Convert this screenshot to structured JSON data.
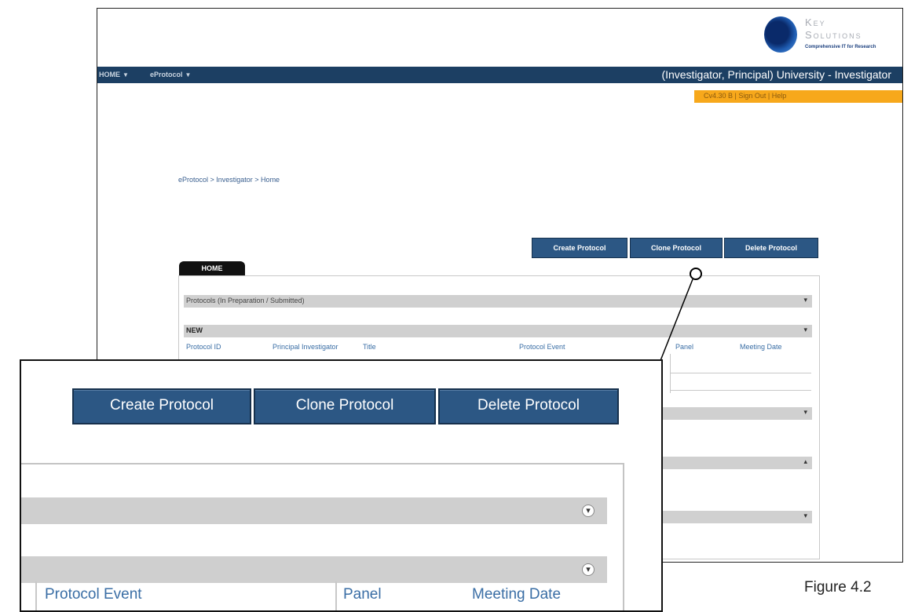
{
  "logo": {
    "line1": "Key",
    "line2": "Solutions",
    "tagline": "Comprehensive IT for Research"
  },
  "navbar": {
    "menus": [
      {
        "label": "HOME"
      },
      {
        "label": "eProtocol"
      }
    ],
    "role_text": "(Investigator, Principal) University - Investigator"
  },
  "userbar": {
    "text": "Cv4.30 B  |  Sign Out  |  Help"
  },
  "breadcrumb": "eProtocol > Investigator > Home",
  "toolbar": {
    "create": "Create Protocol",
    "clone": "Clone Protocol",
    "delete": "Delete Protocol"
  },
  "tab": {
    "label": "HOME"
  },
  "sections": {
    "prep": "Protocols (In Preparation / Submitted)",
    "new": "NEW"
  },
  "columns": [
    "Protocol ID",
    "Principal Investigator",
    "Title",
    "Protocol Event",
    "Panel",
    "Meeting Date"
  ],
  "zoom": {
    "buttons": {
      "create": "Create Protocol",
      "clone": "Clone Protocol",
      "delete": "Delete Protocol"
    },
    "columns": [
      "Protocol Event",
      "Panel",
      "Meeting Date"
    ]
  },
  "caption": "Figure 4.2",
  "colors": {
    "nav": "#1c3f63",
    "button": "#2c5784",
    "accent": "#f7a81b",
    "section_bar": "#d0d0d0"
  }
}
